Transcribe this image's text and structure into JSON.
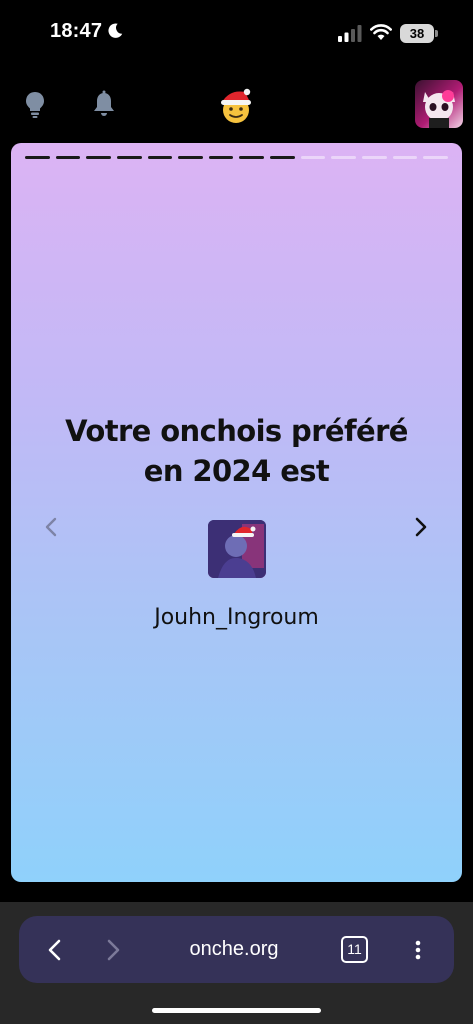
{
  "status_bar": {
    "time": "18:47",
    "battery": "38"
  },
  "top_nav": {
    "icons": [
      "lightbulb-icon",
      "bell-icon",
      "santa-face-icon",
      "profile-avatar"
    ]
  },
  "card": {
    "progress": {
      "total_segments": 14,
      "completed_segments": 9
    },
    "title_line1": "Votre onchois préféré",
    "title_line2": "en 2024 est",
    "username": "Jouhn_Ingroum"
  },
  "browser": {
    "url": "onche.org",
    "tab_count": "11"
  },
  "colors": {
    "card_top": "#dcb3f4",
    "card_bottom": "#8fd1fb",
    "url_bar": "#353258"
  }
}
